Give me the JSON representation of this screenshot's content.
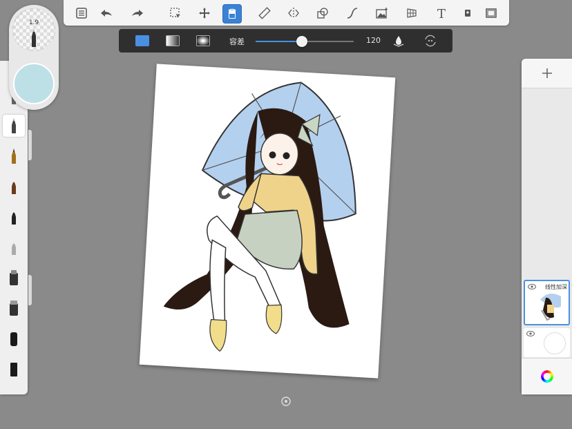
{
  "toolbar": {
    "tools": [
      "brush-library",
      "undo",
      "redo",
      "selection",
      "transform",
      "fill",
      "ruler",
      "symmetry",
      "shape",
      "curve",
      "image",
      "perspective",
      "text",
      "flipbook",
      "fullscreen"
    ],
    "active_tool": "fill"
  },
  "fill_options": {
    "tolerance_label": "容差",
    "tolerance_value": "120",
    "tolerance_fraction": 0.47,
    "accent": "#4a90e2"
  },
  "puck": {
    "brush_size": "1.9",
    "current_color": "#bde0e6"
  },
  "layers": {
    "layer1_name": "线性加深"
  },
  "colors": {
    "background": "#8a8a8a",
    "active_tool": "#3b82d6"
  }
}
